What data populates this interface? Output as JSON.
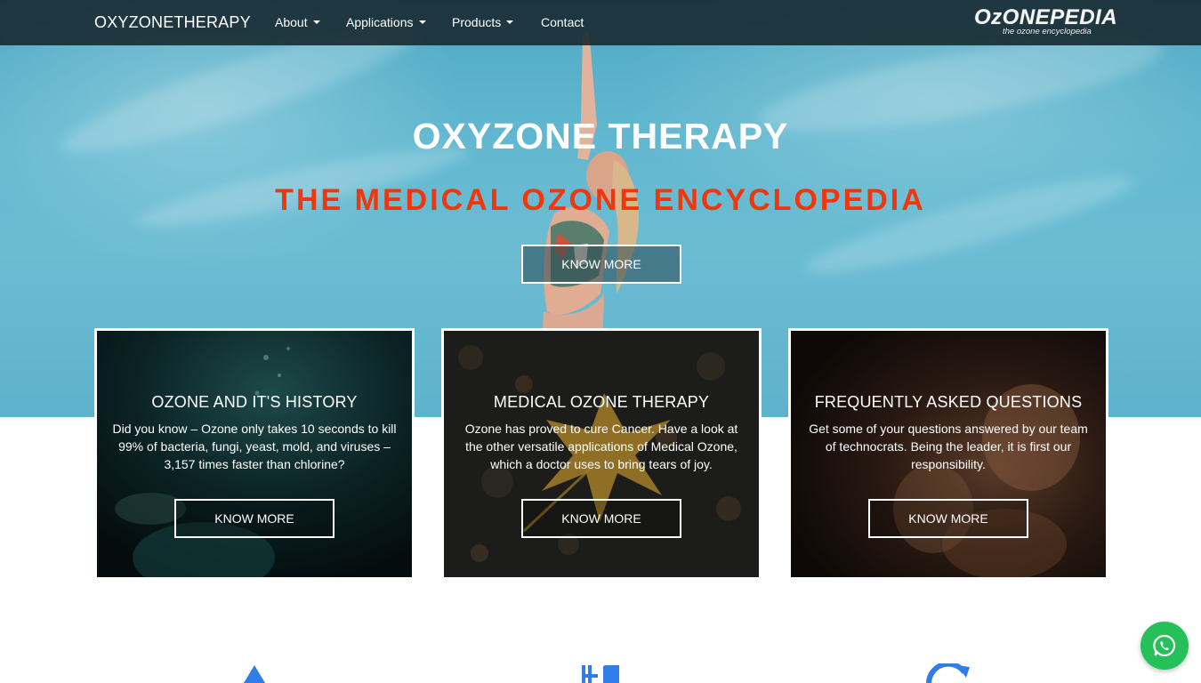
{
  "navbar": {
    "brand": "OXYZONETHERAPY",
    "items": [
      {
        "label": "About",
        "dropdown": true
      },
      {
        "label": "Applications",
        "dropdown": true
      },
      {
        "label": "Products",
        "dropdown": true
      },
      {
        "label": "Contact",
        "dropdown": false
      }
    ],
    "logo": {
      "main": "OzONEPEDIA",
      "tagline": "the ozone encyclopedia"
    }
  },
  "hero": {
    "title": "OXYZONE THERAPY",
    "subtitle": "THE MEDICAL OZONE ENCYCLOPEDIA",
    "button_label": "KNOW MORE"
  },
  "cards": [
    {
      "title": "OZONE AND IT'S HISTORY",
      "text": "Did you know – Ozone only takes 10 seconds to kill 99% of bacteria, fungi, yeast, mold, and viruses – 3,157 times faster than chlorine?",
      "button_label": "KNOW MORE"
    },
    {
      "title": "MEDICAL OZONE THERAPY",
      "text": "Ozone has proved to cure Cancer. Have a look at the other versatile applications of Medical Ozone, which a doctor uses to bring tears of joy.",
      "button_label": "KNOW MORE"
    },
    {
      "title": "FREQUENTLY ASKED QUESTIONS",
      "text": "Get some of your questions answered by our team of technocrats. Being the leader, it is first our responsibility.",
      "button_label": "KNOW MORE"
    }
  ],
  "colors": {
    "navbar_bg": "#16262c",
    "subtitle": "#f0360c",
    "icon_blue": "#2f7de8",
    "whatsapp": "#25c05a"
  },
  "icons": [
    "flask-icon",
    "utensils-icon",
    "refresh-icon",
    "whatsapp-icon"
  ]
}
